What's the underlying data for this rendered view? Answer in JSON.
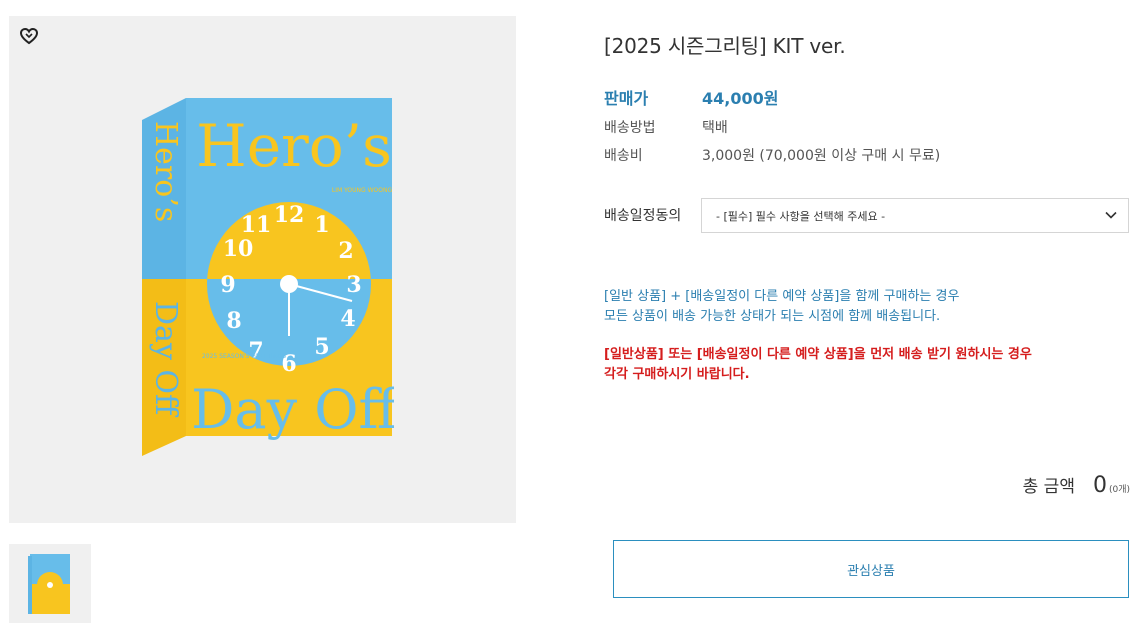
{
  "product": {
    "title": "[2025 시즌그리팅] KIT ver.",
    "price_label": "판매가",
    "price_value": "44,000원",
    "shipping_method_label": "배송방법",
    "shipping_method_value": "택배",
    "shipping_fee_label": "배송비",
    "shipping_fee_value": "3,000원 (70,000원 이상 구매 시 무료)"
  },
  "cover_text": {
    "title_top": "Hero’s",
    "title_bottom": "Day Off",
    "spine_top": "Hero’s",
    "spine_bottom": "Day Off",
    "artist": "LIM YOUNG WOONG",
    "greeting": "2025 SEASON'S GREETINGS"
  },
  "option": {
    "label": "배송일정동의",
    "selected": "- [필수] 필수 사항을 선택해 주세요 -"
  },
  "notice": {
    "blue_line1": "[일반 상품] + [배송일정이 다른 예약 상품]을 함께 구매하는 경우",
    "blue_line2": "모든 상품이 배송 가능한 상태가 되는 시점에 함께 배송됩니다.",
    "red_line1": "[일반상품] 또는 [배송일정이 다른 예약 상품]을 먼저 배송 받기 원하시는 경우",
    "red_line2": "각각 구매하시기 바랍니다."
  },
  "total": {
    "label": "총 금액",
    "value": "0",
    "count": "(0개)"
  },
  "buttons": {
    "wish": "관심상품"
  },
  "colors": {
    "accent_blue": "#2b7fb0",
    "warning_red": "#d51d1d",
    "cover_blue": "#63b8e6",
    "cover_yellow": "#f7c21e"
  },
  "icons": {
    "wish": "heart-outline-icon",
    "dropdown": "chevron-down-icon"
  }
}
